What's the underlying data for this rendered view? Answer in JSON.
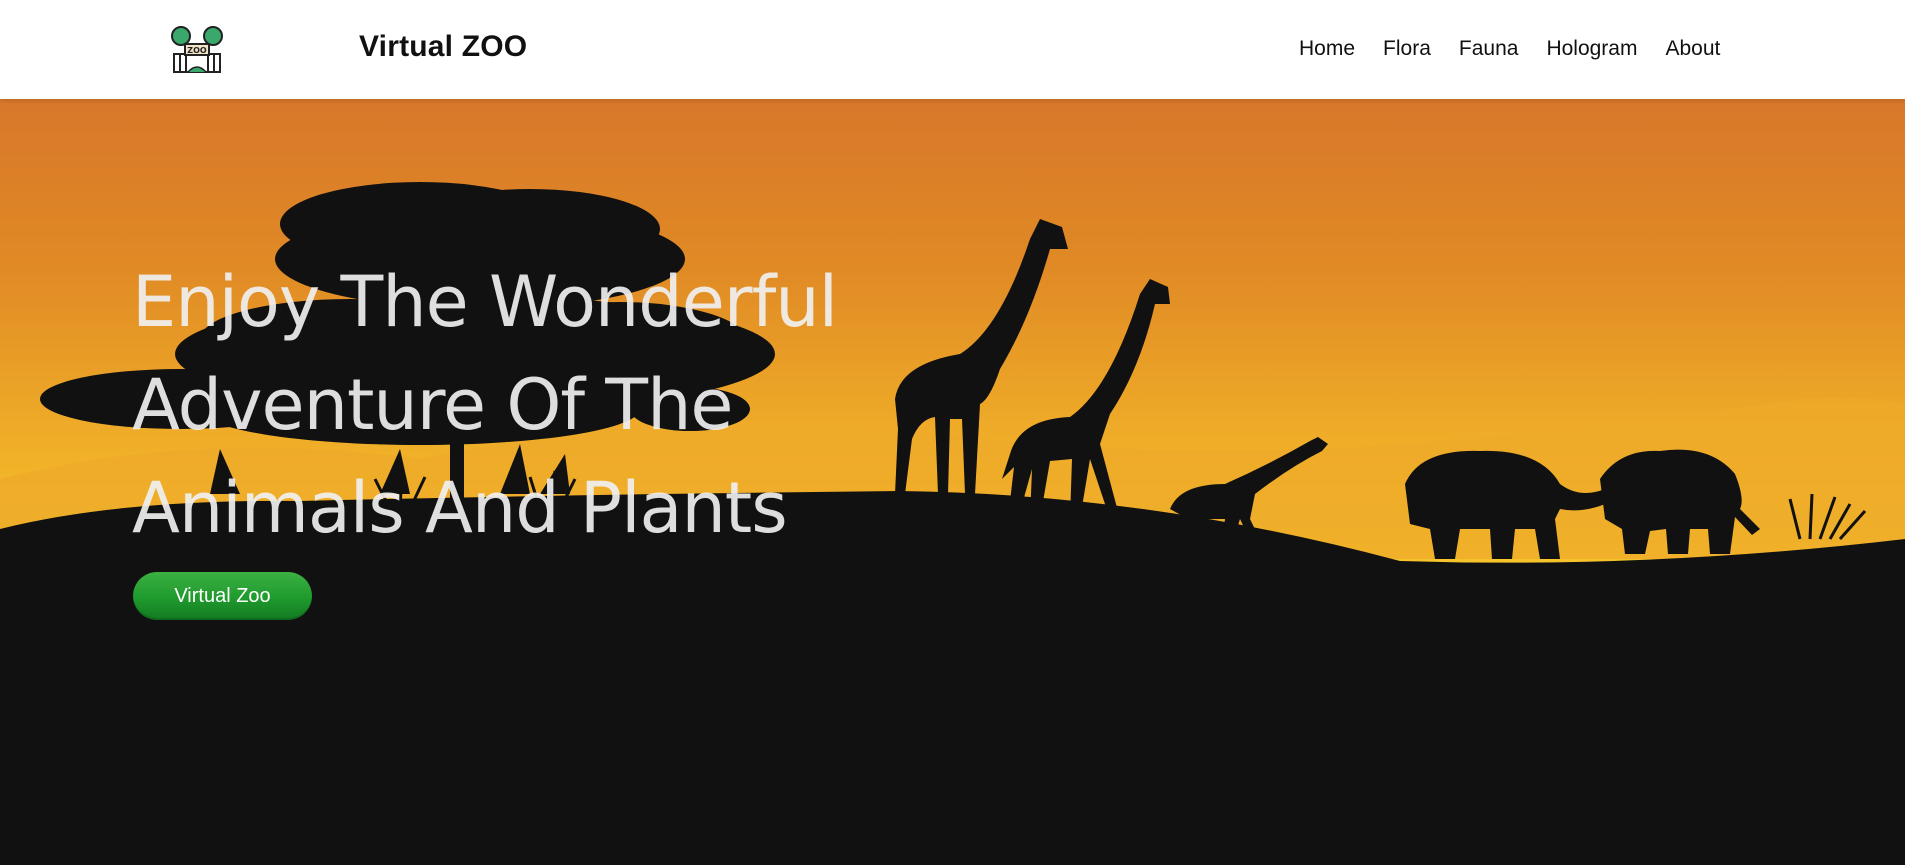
{
  "brand": {
    "name": "Virtual ZOO",
    "logo_icon": "zoo-gate-icon",
    "logo_text": "ZOO"
  },
  "nav": {
    "items": [
      {
        "label": "Home"
      },
      {
        "label": "Flora"
      },
      {
        "label": "Fauna"
      },
      {
        "label": "Hologram"
      },
      {
        "label": "About"
      }
    ]
  },
  "hero": {
    "headline_lines": [
      "Enjoy The Wonderful",
      "Adventure Of The",
      "Animals And Plants"
    ],
    "cta_label": "Virtual Zoo",
    "background": "savanna-sunset-illustration"
  },
  "colors": {
    "navbar_bg": "#ffffff",
    "sky_top": "#dc7a26",
    "sky_bottom": "#f6c52a",
    "silhouette": "#111111",
    "cta": "#1f9a2d",
    "headline_text": "#f0f0f0"
  }
}
